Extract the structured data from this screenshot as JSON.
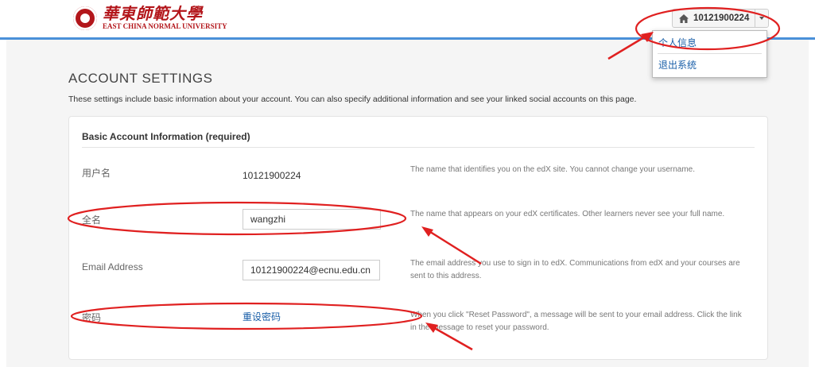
{
  "header": {
    "logo_cn": "華東師範大學",
    "logo_en": "EAST CHINA NORMAL UNIVERSITY",
    "user_id": "10121900224",
    "home_icon": "home-icon",
    "caret_icon": "chevron-down-icon"
  },
  "dropdown": {
    "items": [
      {
        "label": "个人信息"
      },
      {
        "label": "退出系统"
      }
    ]
  },
  "page": {
    "title": "ACCOUNT SETTINGS",
    "subtitle": "These settings include basic information about your account. You can also specify additional information and see your linked social accounts on this page."
  },
  "card": {
    "title": "Basic Account Information (required)",
    "rows": [
      {
        "label": "用户名",
        "value": "10121900224",
        "help": "The name that identifies you on the edX site. You cannot change your username."
      },
      {
        "label": "全名",
        "value": "wangzhi",
        "help": "The name that appears on your edX certificates. Other learners never see your full name."
      },
      {
        "label": "Email Address",
        "value": "10121900224@ecnu.edu.cn",
        "help": "The email address you use to sign in to edX. Communications from edX and your courses are sent to this address."
      },
      {
        "label": "密码",
        "value": "重设密码",
        "help": "When you click \"Reset Password\", a message will be sent to your email address. Click the link in the message to reset your password."
      }
    ]
  },
  "colors": {
    "accent_line": "#4a90d9",
    "link": "#1a5fa8",
    "brand_red": "#b3161b",
    "annotation_red": "#e02020"
  }
}
